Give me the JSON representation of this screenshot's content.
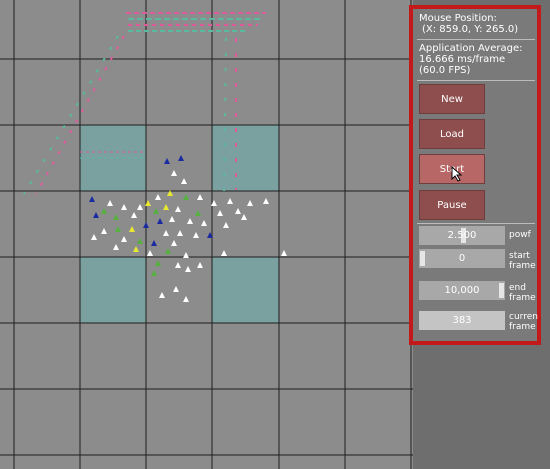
{
  "hud": {
    "mouse_title": "Mouse Position:",
    "mouse_value": "(X: 859.0, Y: 265.0)",
    "avg_title": "Application Average:",
    "avg_ms": "16.666 ms/frame",
    "avg_fps": "(60.0 FPS)"
  },
  "buttons": {
    "new_label": "New",
    "load_label": "Load",
    "start_label": "Start",
    "pause_label": "Pause"
  },
  "fields": {
    "powf_value": "2.500",
    "powf_label": "powf",
    "start_frame_value": "0",
    "start_frame_label": "start frame",
    "end_frame_value": "10,000",
    "end_frame_label": "end frame",
    "current_frame_value": "383",
    "current_frame_label": "curren frame"
  },
  "colors": {
    "grid_background": "#8c8c8c",
    "highlight_cell": "#7aa0a0",
    "panel_border": "#c21a1a",
    "button": "#8e4e4e",
    "button_hover": "#b86767",
    "particle_white": "#ffffff",
    "particle_blue": "#1a2aa0",
    "particle_yellow": "#e8e830",
    "particle_green": "#55b040"
  }
}
